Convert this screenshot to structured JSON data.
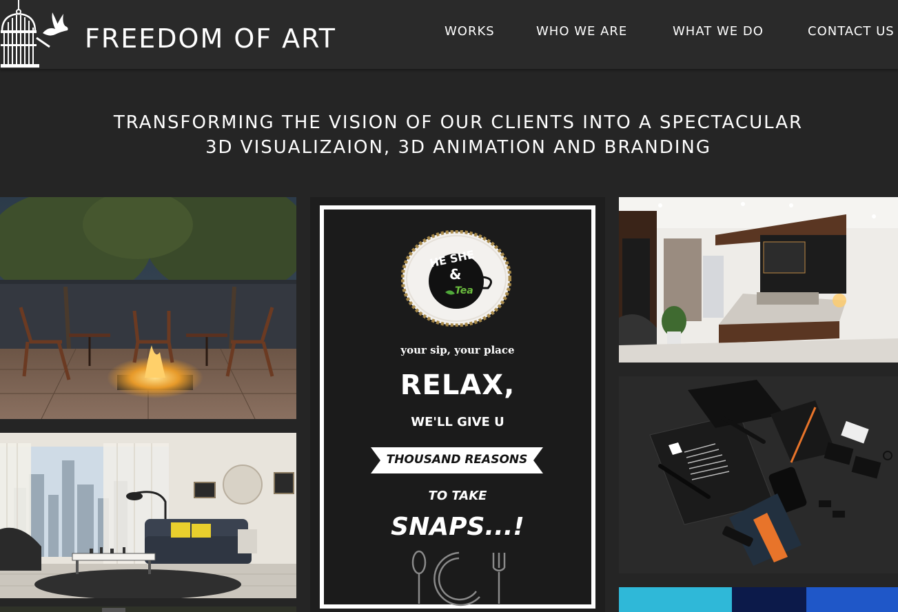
{
  "brand": {
    "name": "FREEDOM OF ART"
  },
  "nav": {
    "items": [
      {
        "label": "WORKS"
      },
      {
        "label": "WHO WE ARE"
      },
      {
        "label": "WHAT WE DO"
      },
      {
        "label": "CONTACT US"
      }
    ]
  },
  "hero": {
    "line1": "TRANSFORMING THE VISION OF OUR CLIENTS INTO A SPECTACULAR",
    "line2": "3D VISUALIZAION, 3D ANIMATION AND BRANDING"
  },
  "poster": {
    "logo_top": "HE SHE",
    "logo_amp": "&",
    "logo_bottom": "Tea",
    "tagline": "your sip, your place",
    "relax": "RELAX,",
    "give": "WE'LL GIVE U",
    "ribbon": "THOUSAND REASONS",
    "take": "TO TAKE",
    "snaps": "SNAPS...!"
  },
  "colors": {
    "page_bg": "#252525",
    "header_bg": "#2a2a2a",
    "accent_orange": "#e8742a",
    "stripe_cyan": "#2fb8d8",
    "stripe_navy": "#0c1a4a",
    "stripe_blue": "#1f57c8"
  }
}
